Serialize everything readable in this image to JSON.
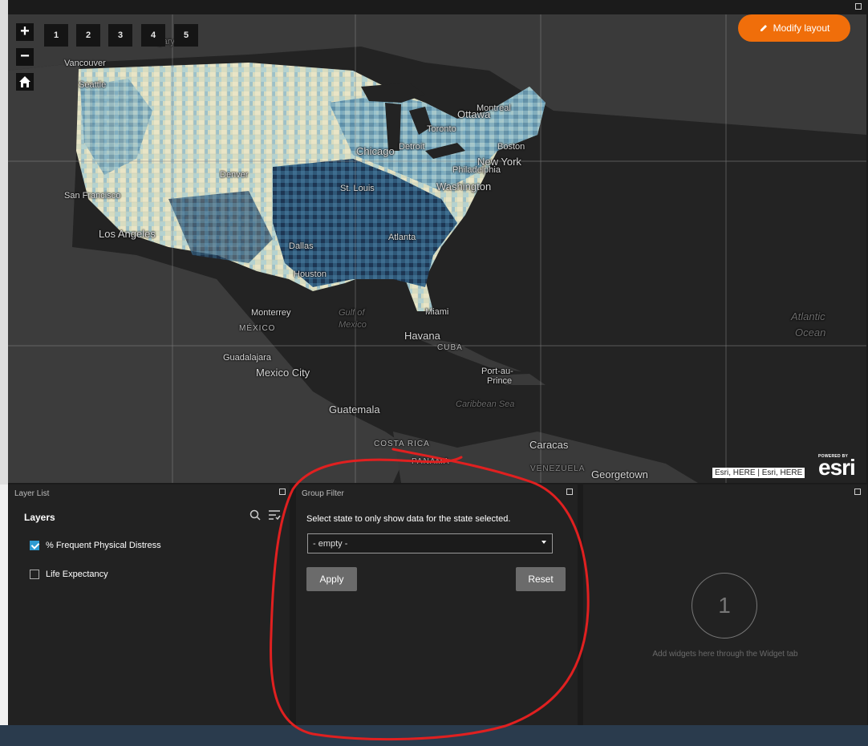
{
  "map": {
    "zoom_in": "+",
    "zoom_out": "−",
    "home_icon": "home-icon",
    "bookmarks": [
      "1",
      "2",
      "3",
      "4",
      "5"
    ],
    "modify_layout": "Modify layout",
    "attribution": "Esri, HERE | Esri, HERE",
    "esri_powered": "POWERED BY",
    "esri_word": "esri",
    "labels": {
      "vancouver": "Vancouver",
      "seattle": "Seattle",
      "calgary": "Calgary",
      "montreal": "Montreal",
      "ottawa": "Ottawa",
      "toronto": "Toronto",
      "detroit": "Detroit",
      "chicago": "Chicago",
      "boston": "Boston",
      "new_york": "New York",
      "philadelphia": "Philadelphia",
      "washington": "Washington",
      "denver": "Denver",
      "st_louis": "St. Louis",
      "san_francisco": "San Francisco",
      "los_angeles": "Los Angeles",
      "dallas": "Dallas",
      "atlanta": "Atlanta",
      "houston": "Houston",
      "miami": "Miami",
      "monterrey": "Monterrey",
      "mexico": "MÉXICO",
      "gulf_of_mexico_1": "Gulf of",
      "gulf_of_mexico_2": "Mexico",
      "havana": "Havana",
      "cuba": "CUBA",
      "atlantic_1": "Atlantic",
      "atlantic_2": "Ocean",
      "guadalajara": "Guadalajara",
      "mexico_city": "Mexico City",
      "port_au_prince_1": "Port-au-",
      "port_au_prince_2": "Prince",
      "caribbean_sea": "Caribbean Sea",
      "guatemala": "Guatemala",
      "costa_rica": "COSTA RICA",
      "caracas": "Caracas",
      "panama": "PANAMA",
      "venezuela": "VENEZUELA",
      "georgetown": "Georgetown"
    }
  },
  "layer_list": {
    "title": "Layer List",
    "heading": "Layers",
    "layers": [
      {
        "label": "% Frequent Physical Distress",
        "checked": true
      },
      {
        "label": "Life Expectancy",
        "checked": false
      }
    ]
  },
  "group_filter": {
    "title": "Group Filter",
    "description": "Select state to only show data for the state selected.",
    "select_value": "- empty -",
    "apply_label": "Apply",
    "reset_label": "Reset"
  },
  "placeholder": {
    "number": "1",
    "text": "Add widgets here through the Widget tab"
  },
  "colors": {
    "accent": "#f06e0a",
    "checkbox": "#2e9bd1",
    "annotation": "#e02020",
    "choropleth": [
      "#e9e5c6",
      "#b4d2d0",
      "#75a7bd",
      "#3e6d8f",
      "#1d3653"
    ]
  }
}
